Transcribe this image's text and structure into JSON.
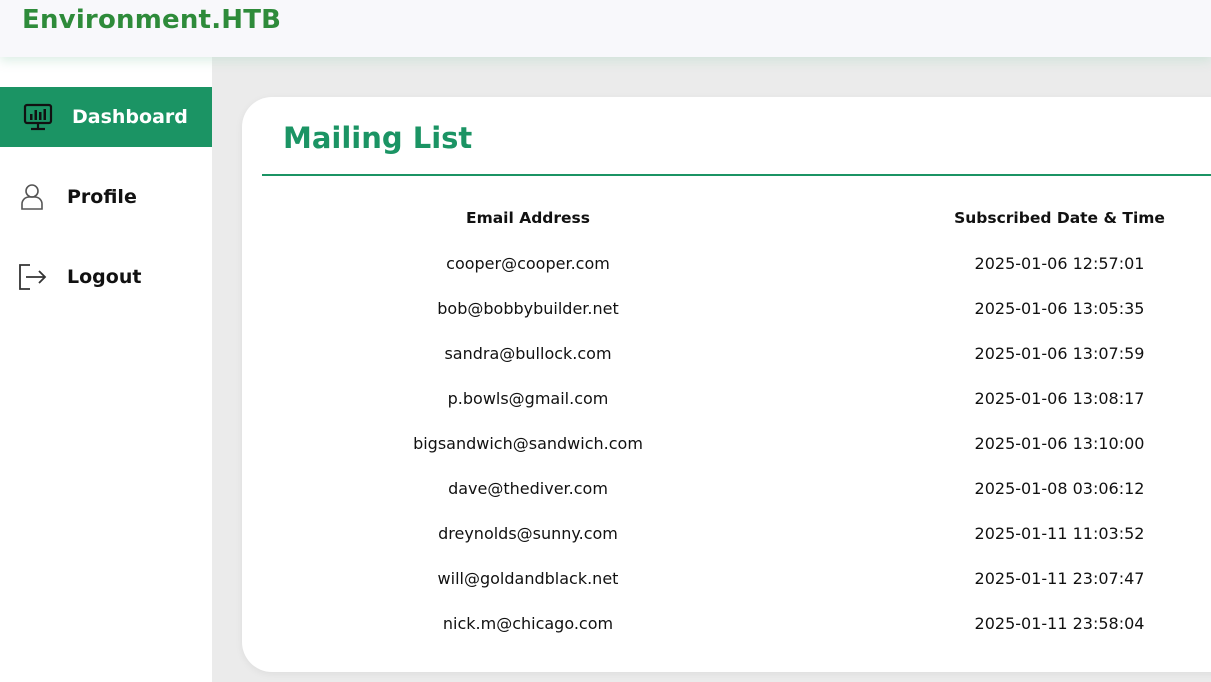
{
  "app": {
    "title": "Environment.HTB"
  },
  "sidebar": {
    "items": [
      {
        "label": "Dashboard",
        "icon": "dashboard-monitor-icon",
        "active": true
      },
      {
        "label": "Profile",
        "icon": "user-icon",
        "active": false
      },
      {
        "label": "Logout",
        "icon": "logout-icon",
        "active": false
      }
    ]
  },
  "main": {
    "title": "Mailing List",
    "table": {
      "columns": [
        "Email Address",
        "Subscribed Date & Time"
      ],
      "rows": [
        [
          "cooper@cooper.com",
          "2025-01-06 12:57:01"
        ],
        [
          "bob@bobbybuilder.net",
          "2025-01-06 13:05:35"
        ],
        [
          "sandra@bullock.com",
          "2025-01-06 13:07:59"
        ],
        [
          "p.bowls@gmail.com",
          "2025-01-06 13:08:17"
        ],
        [
          "bigsandwich@sandwich.com",
          "2025-01-06 13:10:00"
        ],
        [
          "dave@thediver.com",
          "2025-01-08 03:06:12"
        ],
        [
          "dreynolds@sunny.com",
          "2025-01-11 11:03:52"
        ],
        [
          "will@goldandblack.net",
          "2025-01-11 23:07:47"
        ],
        [
          "nick.m@chicago.com",
          "2025-01-11 23:58:04"
        ]
      ]
    }
  },
  "colors": {
    "brand": "#2e8b3a",
    "accent": "#1b9464",
    "background": "#ebebeb"
  }
}
